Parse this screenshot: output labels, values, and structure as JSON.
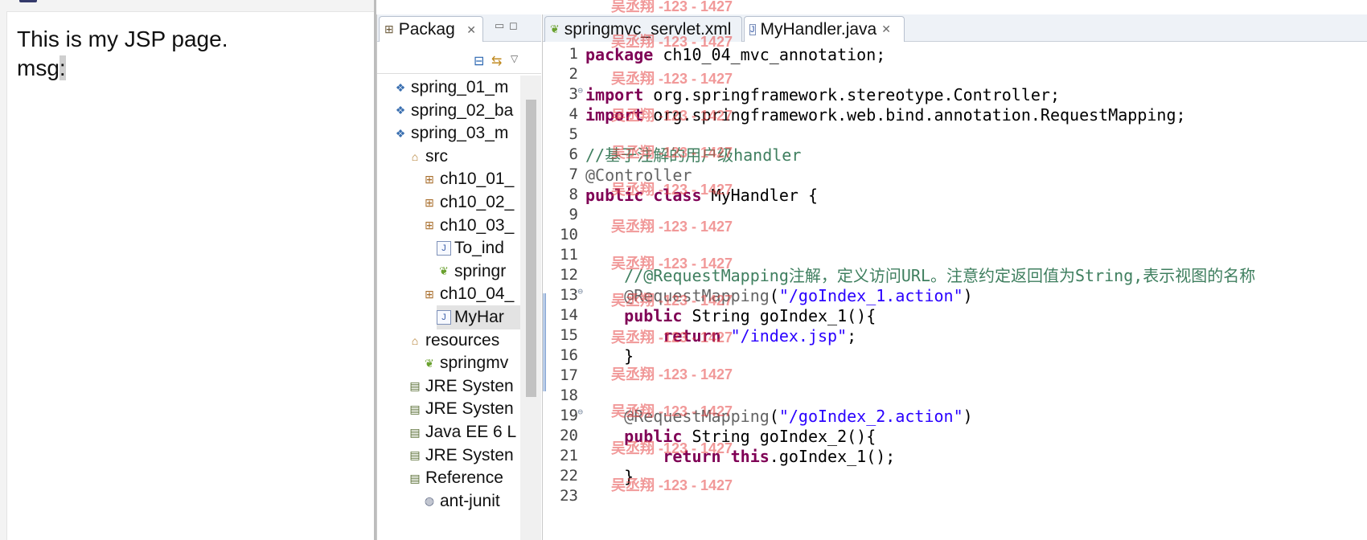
{
  "browser": {
    "line1": "This is my JSP page.",
    "line2_label": "msg",
    "line2_caret": ":"
  },
  "explorer": {
    "tab_label": "Packag",
    "tree": [
      {
        "label": "spring_01_m",
        "icon": "project-icon",
        "indent": 0
      },
      {
        "label": "spring_02_ba",
        "icon": "project-icon",
        "indent": 0
      },
      {
        "label": "spring_03_m",
        "icon": "project-icon",
        "indent": 0
      },
      {
        "label": "src",
        "icon": "source-folder-icon",
        "indent": 1
      },
      {
        "label": "ch10_01_",
        "icon": "package-icon",
        "indent": 2
      },
      {
        "label": "ch10_02_",
        "icon": "package-icon",
        "indent": 2
      },
      {
        "label": "ch10_03_",
        "icon": "package-icon",
        "indent": 2
      },
      {
        "label": "To_ind",
        "icon": "java-file-icon",
        "indent": 3
      },
      {
        "label": "springr",
        "icon": "spring-xml-icon",
        "indent": 3
      },
      {
        "label": "ch10_04_",
        "icon": "package-icon",
        "indent": 2
      },
      {
        "label": "MyHar",
        "icon": "java-file-icon",
        "indent": 3,
        "selected": true
      },
      {
        "label": "resources",
        "icon": "source-folder-icon",
        "indent": 1
      },
      {
        "label": "springmv",
        "icon": "spring-xml-icon",
        "indent": 2
      },
      {
        "label": "JRE Systen",
        "icon": "library-icon",
        "indent": 1
      },
      {
        "label": "JRE Systen",
        "icon": "library-icon",
        "indent": 1
      },
      {
        "label": "Java EE 6 L",
        "icon": "library-icon",
        "indent": 1
      },
      {
        "label": "JRE Systen",
        "icon": "library-icon",
        "indent": 1
      },
      {
        "label": "Reference",
        "icon": "library-icon",
        "indent": 1
      },
      {
        "label": "ant-junit",
        "icon": "jar-icon",
        "indent": 2
      }
    ]
  },
  "editor": {
    "tabs": [
      {
        "label": "springmvc_servlet.xml",
        "icon": "spring-xml-icon",
        "active": false
      },
      {
        "label": "MyHandler.java",
        "icon": "java-file-icon",
        "active": true
      }
    ],
    "lines": [
      {
        "n": "1",
        "parts": [
          {
            "t": "kw",
            "v": "package"
          },
          {
            "t": "p",
            "v": " ch10_04_mvc_annotation;"
          }
        ]
      },
      {
        "n": "2",
        "parts": []
      },
      {
        "n": "3",
        "fold": true,
        "parts": [
          {
            "t": "kw",
            "v": "import"
          },
          {
            "t": "p",
            "v": " org.springframework.stereotype.Controller;"
          }
        ]
      },
      {
        "n": "4",
        "parts": [
          {
            "t": "kw",
            "v": "import"
          },
          {
            "t": "p",
            "v": " org.springframework.web.bind.annotation.RequestMapping;"
          }
        ]
      },
      {
        "n": "5",
        "parts": []
      },
      {
        "n": "6",
        "parts": [
          {
            "t": "cm",
            "v": "//基于注解的用户级handler"
          }
        ]
      },
      {
        "n": "7",
        "parts": [
          {
            "t": "ann",
            "v": "@Controller"
          }
        ]
      },
      {
        "n": "8",
        "parts": [
          {
            "t": "kw",
            "v": "public"
          },
          {
            "t": "p",
            "v": " "
          },
          {
            "t": "kw",
            "v": "class"
          },
          {
            "t": "p",
            "v": " MyHandler {"
          }
        ]
      },
      {
        "n": "9",
        "parts": []
      },
      {
        "n": "10",
        "parts": []
      },
      {
        "n": "11",
        "parts": []
      },
      {
        "n": "12",
        "parts": [
          {
            "t": "p",
            "v": "    "
          },
          {
            "t": "cm",
            "v": "//@RequestMapping注解，定义访问URL。注意约定返回值为String,表示视图的名称"
          }
        ]
      },
      {
        "n": "13",
        "fold": true,
        "parts": [
          {
            "t": "p",
            "v": "    "
          },
          {
            "t": "ann",
            "v": "@RequestMapping"
          },
          {
            "t": "p",
            "v": "("
          },
          {
            "t": "str",
            "v": "\"/goIndex_1.action\""
          },
          {
            "t": "p",
            "v": ")"
          }
        ]
      },
      {
        "n": "14",
        "parts": [
          {
            "t": "p",
            "v": "    "
          },
          {
            "t": "kw",
            "v": "public"
          },
          {
            "t": "p",
            "v": " String goIndex_1(){"
          }
        ]
      },
      {
        "n": "15",
        "parts": [
          {
            "t": "p",
            "v": "        "
          },
          {
            "t": "kw",
            "v": "return"
          },
          {
            "t": "p",
            "v": " "
          },
          {
            "t": "str",
            "v": "\"/index.jsp\""
          },
          {
            "t": "p",
            "v": ";"
          }
        ]
      },
      {
        "n": "16",
        "parts": [
          {
            "t": "p",
            "v": "    }"
          }
        ]
      },
      {
        "n": "17",
        "parts": []
      },
      {
        "n": "18",
        "parts": []
      },
      {
        "n": "19",
        "fold": true,
        "parts": [
          {
            "t": "p",
            "v": "    "
          },
          {
            "t": "ann",
            "v": "@RequestMapping"
          },
          {
            "t": "p",
            "v": "("
          },
          {
            "t": "str",
            "v": "\"/goIndex_2.action\""
          },
          {
            "t": "p",
            "v": ")"
          }
        ]
      },
      {
        "n": "20",
        "parts": [
          {
            "t": "p",
            "v": "    "
          },
          {
            "t": "kw",
            "v": "public"
          },
          {
            "t": "p",
            "v": " String goIndex_2(){"
          }
        ]
      },
      {
        "n": "21",
        "parts": [
          {
            "t": "p",
            "v": "        "
          },
          {
            "t": "kw",
            "v": "return"
          },
          {
            "t": "p",
            "v": " "
          },
          {
            "t": "kw",
            "v": "this"
          },
          {
            "t": "p",
            "v": ".goIndex_1();"
          }
        ]
      },
      {
        "n": "22",
        "parts": [
          {
            "t": "p",
            "v": "    }"
          }
        ]
      },
      {
        "n": "23",
        "parts": []
      }
    ]
  },
  "watermark": "吴丞翔 -123 - 1427",
  "colors": {
    "keyword": "#7f0055",
    "comment": "#3f7f5f",
    "annotation": "#646464",
    "string": "#2a00ff",
    "watermark": "#e64646"
  }
}
